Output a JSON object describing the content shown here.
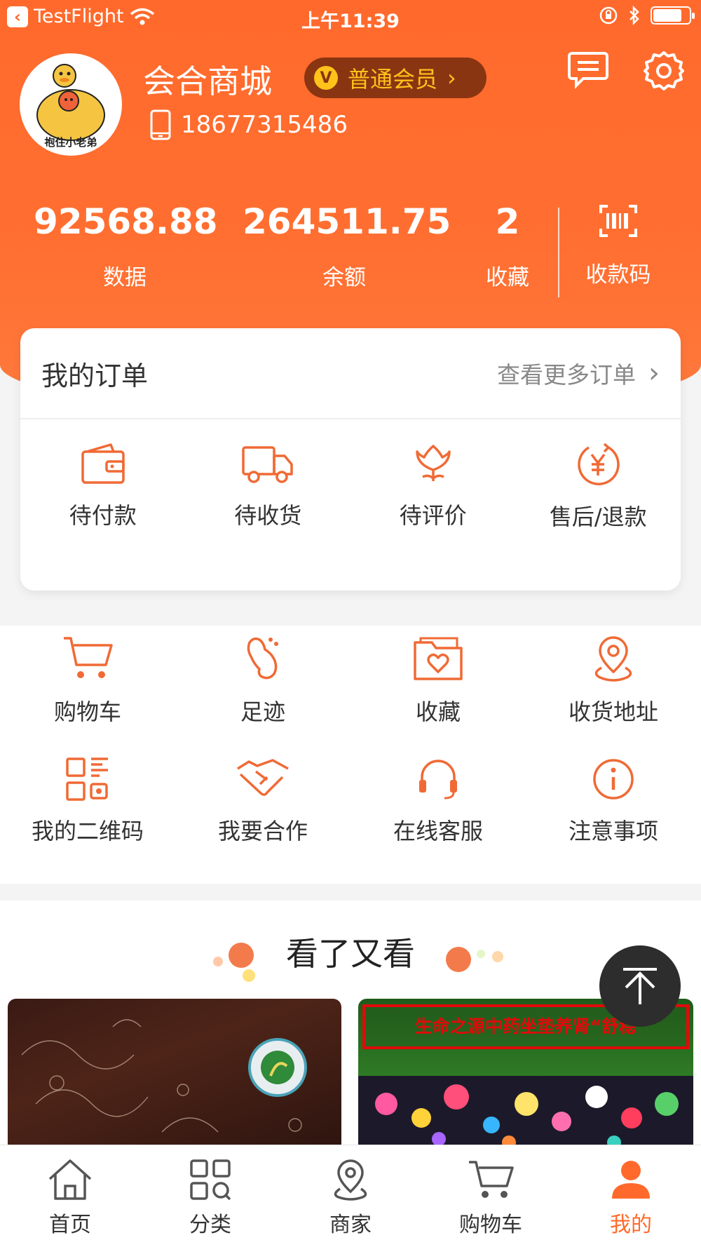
{
  "status_bar": {
    "back_app": "TestFlight",
    "time": "上午11:39",
    "battery_level": 0.8
  },
  "profile": {
    "store_name": "会合商城",
    "member_level": "普通会员",
    "member_badge_letter": "V",
    "phone": "18677315486",
    "avatar_caption": "抱住小老弟"
  },
  "stats": [
    {
      "value": "92568.88",
      "label": "数据"
    },
    {
      "value": "264511.75",
      "label": "余额"
    },
    {
      "value": "2",
      "label": "收藏"
    },
    {
      "label": "收款码",
      "icon": "barcode-icon"
    }
  ],
  "orders": {
    "title": "我的订单",
    "more_label": "查看更多订单",
    "items": [
      {
        "label": "待付款",
        "icon": "wallet-icon"
      },
      {
        "label": "待收货",
        "icon": "truck-icon"
      },
      {
        "label": "待评价",
        "icon": "flower-icon"
      },
      {
        "label": "售后/退款",
        "icon": "yen-refund-icon"
      }
    ]
  },
  "services": [
    {
      "label": "购物车",
      "icon": "cart-icon"
    },
    {
      "label": "足迹",
      "icon": "footprint-icon"
    },
    {
      "label": "收藏",
      "icon": "heart-folder-icon"
    },
    {
      "label": "收货地址",
      "icon": "location-icon"
    },
    {
      "label": "我的二维码",
      "icon": "qr-code-icon"
    },
    {
      "label": "我要合作",
      "icon": "handshake-icon"
    },
    {
      "label": "在线客服",
      "icon": "headset-icon"
    },
    {
      "label": "注意事项",
      "icon": "info-icon"
    }
  ],
  "recommend": {
    "title": "看了又看",
    "products": [
      {
        "image": "dark-floral-package"
      },
      {
        "banner_text": "生命之源中药坐垫养肾“舒稳"
      }
    ]
  },
  "tabbar": {
    "items": [
      {
        "label": "首页",
        "icon": "home-icon"
      },
      {
        "label": "分类",
        "icon": "category-icon"
      },
      {
        "label": "商家",
        "icon": "merchant-location-icon"
      },
      {
        "label": "购物车",
        "icon": "cart-icon"
      },
      {
        "label": "我的",
        "icon": "user-icon",
        "active": true
      }
    ]
  },
  "colors": {
    "brand": "#ff6a2c",
    "badge_bg": "#8a3512",
    "badge_text": "#ffc21a",
    "scroll_top_bg": "#2d2d2d"
  }
}
